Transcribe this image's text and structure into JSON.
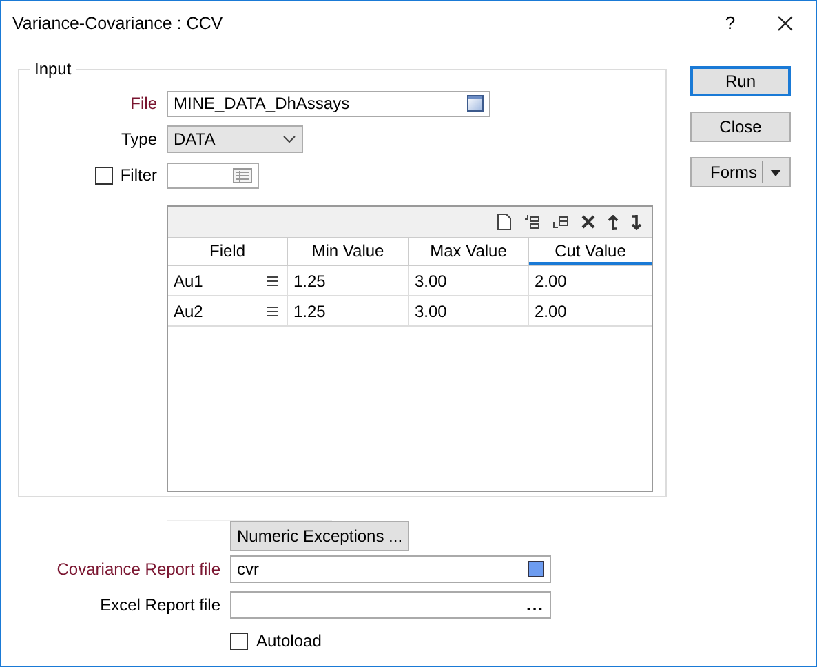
{
  "window": {
    "title": "Variance-Covariance : CCV",
    "help": "?"
  },
  "input_group": {
    "title": "Input",
    "file": {
      "label": "File",
      "value": "MINE_DATA_DhAssays",
      "required": true
    },
    "type": {
      "label": "Type",
      "value": "DATA",
      "required": false
    },
    "filter": {
      "label": "Filter",
      "checked": false
    },
    "grid": {
      "columns": [
        {
          "label": "Field",
          "selected": false
        },
        {
          "label": "Min Value",
          "selected": false
        },
        {
          "label": "Max Value",
          "selected": false
        },
        {
          "label": "Cut Value",
          "selected": true
        }
      ],
      "rows": [
        [
          "Au1",
          "1.25",
          "3.00",
          "2.00"
        ],
        [
          "Au2",
          "1.25",
          "3.00",
          "2.00"
        ]
      ]
    }
  },
  "buttons": [
    {
      "label": "Run",
      "default": true
    },
    {
      "label": "Close",
      "default": false
    }
  ],
  "forms_button": {
    "label": "Forms"
  },
  "numeric_exceptions": {
    "label": "Numeric Exceptions ..."
  },
  "covariance_report": {
    "label": "Covariance Report file",
    "value": "cvr",
    "required": true
  },
  "excel_report": {
    "label": "Excel Report file",
    "required": false,
    "browse": "..."
  },
  "autoload": {
    "label": "Autoload",
    "checked": false
  }
}
